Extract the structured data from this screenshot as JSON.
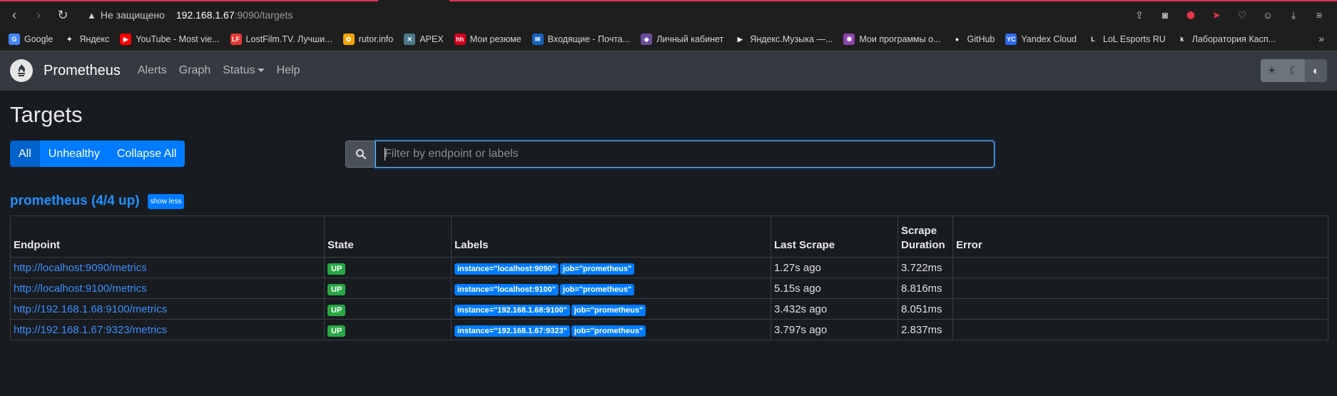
{
  "browser": {
    "not_secure": "Не защищено",
    "host": "192.168.1.67",
    "path": ":9090/targets",
    "bookmarks": [
      {
        "label": "Google",
        "color": "#4285f4",
        "glyph": "G"
      },
      {
        "label": "Яндекс",
        "color": "#1e1e1e",
        "glyph": "✦"
      },
      {
        "label": "YouTube - Most vie...",
        "color": "#ff0000",
        "glyph": "▶"
      },
      {
        "label": "LostFilm.TV. Лучши...",
        "color": "#e53935",
        "glyph": "LF"
      },
      {
        "label": "rutor.info",
        "color": "#f4a300",
        "glyph": "✿"
      },
      {
        "label": "APEX",
        "color": "#4a7a8c",
        "glyph": "✕"
      },
      {
        "label": "Мои резюме",
        "color": "#d6001c",
        "glyph": "hh"
      },
      {
        "label": "Входящие - Почта...",
        "color": "#1565c0",
        "glyph": "✉"
      },
      {
        "label": "Личный кабинет",
        "color": "#6d4c9f",
        "glyph": "◆"
      },
      {
        "label": "Яндекс.Музыка —...",
        "color": "#1e1e1e",
        "glyph": "▶"
      },
      {
        "label": "Мои программы о...",
        "color": "#8e44ad",
        "glyph": "✽"
      },
      {
        "label": "GitHub",
        "color": "#1e1e1e",
        "glyph": "●"
      },
      {
        "label": "Yandex Cloud",
        "color": "#2d6bf0",
        "glyph": "YC"
      },
      {
        "label": "LoL Esports RU",
        "color": "#1e1e1e",
        "glyph": "L"
      },
      {
        "label": "Лаборатория Касп...",
        "color": "#1e1e1e",
        "glyph": "k"
      }
    ]
  },
  "navbar": {
    "brand": "Prometheus",
    "links": [
      "Alerts",
      "Graph",
      "Status",
      "Help"
    ]
  },
  "page": {
    "title": "Targets",
    "filters": [
      "All",
      "Unhealthy",
      "Collapse All"
    ],
    "search_placeholder": "Filter by endpoint or labels",
    "pool_title": "prometheus (4/4 up)",
    "show_less": "show less"
  },
  "table": {
    "headers": [
      "Endpoint",
      "State",
      "Labels",
      "Last Scrape",
      "Scrape Duration",
      "Error"
    ],
    "rows": [
      {
        "endpoint": "http://localhost:9090/metrics",
        "state": "UP",
        "labels": [
          "instance=\"localhost:9090\"",
          "job=\"prometheus\""
        ],
        "last_scrape": "1.27s ago",
        "duration": "3.722ms",
        "error": ""
      },
      {
        "endpoint": "http://localhost:9100/metrics",
        "state": "UP",
        "labels": [
          "instance=\"localhost:9100\"",
          "job=\"prometheus\""
        ],
        "last_scrape": "5.15s ago",
        "duration": "8.816ms",
        "error": ""
      },
      {
        "endpoint": "http://192.168.1.68:9100/metrics",
        "state": "UP",
        "labels": [
          "instance=\"192.168.1.68:9100\"",
          "job=\"prometheus\""
        ],
        "last_scrape": "3.432s ago",
        "duration": "8.051ms",
        "error": ""
      },
      {
        "endpoint": "http://192.168.1.67:9323/metrics",
        "state": "UP",
        "labels": [
          "instance=\"192.168.1.67:9323\"",
          "job=\"prometheus\""
        ],
        "last_scrape": "3.797s ago",
        "duration": "2.837ms",
        "error": ""
      }
    ]
  }
}
